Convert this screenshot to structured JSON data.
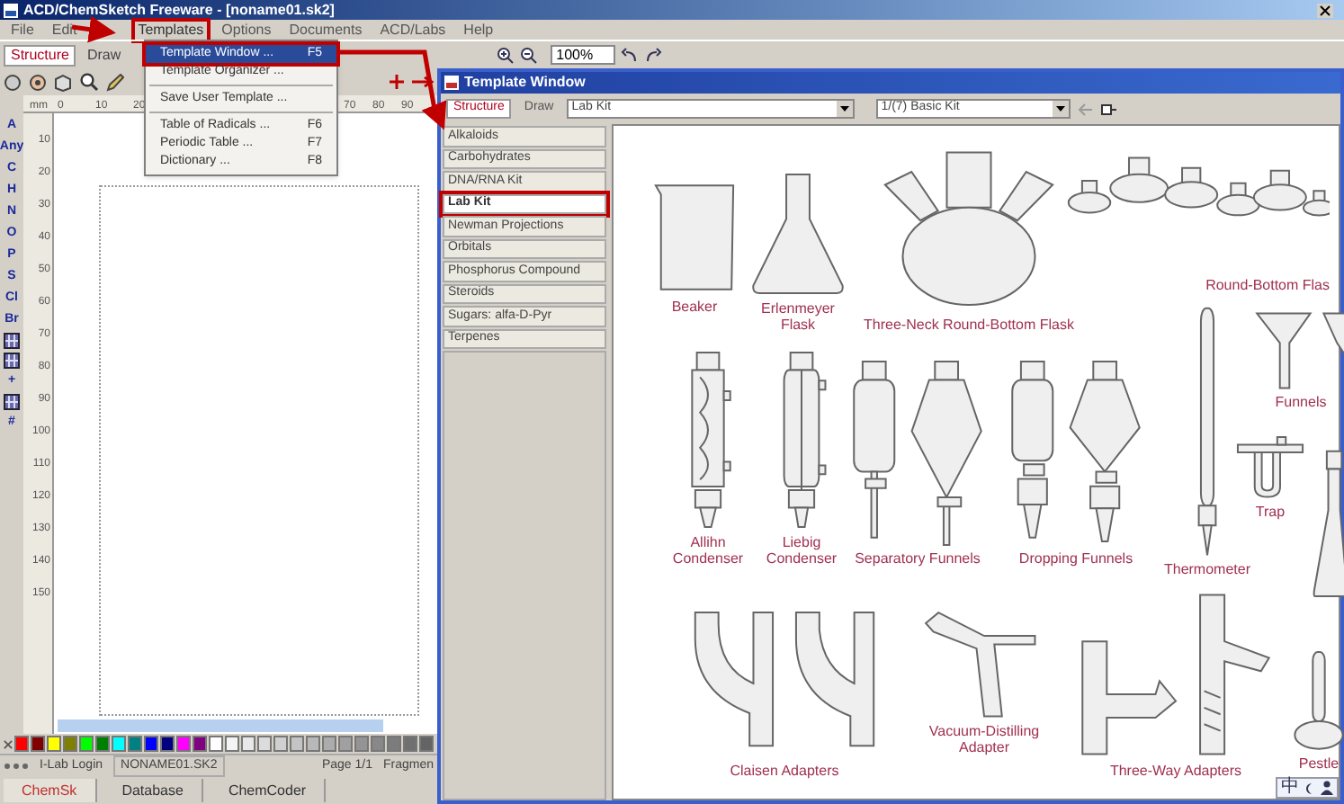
{
  "window": {
    "title": "ACD/ChemSketch Freeware - [noname01.sk2]"
  },
  "menu_bar": [
    {
      "label": "File",
      "highlighted": false
    },
    {
      "label": "Edit",
      "highlighted": false
    },
    {
      "label": "Templates",
      "highlighted": true
    },
    {
      "label": "Options",
      "highlighted": false
    },
    {
      "label": "Documents",
      "highlighted": false
    },
    {
      "label": "ACD/Labs",
      "highlighted": false
    },
    {
      "label": "Help",
      "highlighted": false
    }
  ],
  "templates_menu": [
    {
      "kind": "item",
      "label": "Template Window ...",
      "shortcut": "F5",
      "selected": true,
      "highlighted": true
    },
    {
      "kind": "item",
      "label": "Template Organizer ...",
      "selected": false,
      "highlighted": false
    },
    {
      "kind": "separator"
    },
    {
      "kind": "item",
      "label": "Save User Template ...",
      "selected": false,
      "highlighted": false
    },
    {
      "kind": "separator"
    },
    {
      "kind": "item",
      "label": "Table of Radicals ...",
      "shortcut": "F6",
      "selected": false,
      "highlighted": false
    },
    {
      "kind": "item",
      "label": "Periodic Table ...",
      "shortcut": "F7",
      "selected": false,
      "highlighted": false
    },
    {
      "kind": "item",
      "label": "Dictionary ...",
      "shortcut": "F8",
      "selected": false,
      "highlighted": false
    }
  ],
  "mode_tabs": [
    {
      "label": "Structure",
      "selected": true
    },
    {
      "label": "Draw",
      "selected": false
    }
  ],
  "zoom_field": {
    "value": "100%"
  },
  "ruler": {
    "unit": "mm",
    "left_ticks": [
      "0",
      "10",
      "20"
    ],
    "right_ticks": [
      "70",
      "80",
      "90"
    ],
    "vertical_ticks": [
      "10",
      "20",
      "30",
      "40",
      "50",
      "60",
      "70",
      "80",
      "90",
      "100",
      "110",
      "120",
      "130",
      "140",
      "150"
    ]
  },
  "atom_toolbar": [
    {
      "kind": "label",
      "label": "A"
    },
    {
      "kind": "label",
      "label": "Any"
    },
    {
      "kind": "label",
      "label": "C"
    },
    {
      "kind": "label",
      "label": "H"
    },
    {
      "kind": "label",
      "label": "N"
    },
    {
      "kind": "label",
      "label": "O"
    },
    {
      "kind": "label",
      "label": "P"
    },
    {
      "kind": "label",
      "label": "S"
    },
    {
      "kind": "label",
      "label": "Cl"
    },
    {
      "kind": "label",
      "label": "Br"
    },
    {
      "kind": "icon"
    },
    {
      "kind": "icon"
    },
    {
      "kind": "label",
      "label": "+"
    },
    {
      "kind": "icon"
    },
    {
      "kind": "label",
      "label": "#"
    }
  ],
  "palette": [
    {
      "color": "#ff0000"
    },
    {
      "color": "#800000"
    },
    {
      "color": "#ffff00"
    },
    {
      "color": "#808000"
    },
    {
      "color": "#00ff00"
    },
    {
      "color": "#008000"
    },
    {
      "color": "#00ffff"
    },
    {
      "color": "#008080"
    },
    {
      "color": "#0000ff"
    },
    {
      "color": "#000080"
    },
    {
      "color": "#ff00ff"
    },
    {
      "color": "#800080"
    },
    {
      "color": "#ffffff"
    },
    {
      "color": "#f4f4f4"
    },
    {
      "color": "#e8e8e8"
    },
    {
      "color": "#dcdcdc"
    },
    {
      "color": "#d0d0d0"
    },
    {
      "color": "#c4c4c4"
    },
    {
      "color": "#b8b8b8"
    },
    {
      "color": "#acacac"
    },
    {
      "color": "#a0a0a0"
    },
    {
      "color": "#949494"
    },
    {
      "color": "#888888"
    },
    {
      "color": "#7c7c7c"
    },
    {
      "color": "#707070"
    },
    {
      "color": "#646464"
    }
  ],
  "status_bar": {
    "login": "I-Lab Login",
    "file": "NONAME01.SK2",
    "page": "Page 1/1",
    "mode": "Fragmen"
  },
  "bottom_tabs": [
    {
      "label": "ChemSk",
      "selected": true
    },
    {
      "label": "Database",
      "selected": false
    },
    {
      "label": "ChemCoder",
      "selected": false
    }
  ],
  "template_window": {
    "title": "Template Window",
    "tabs": [
      {
        "label": "Structure",
        "selected": true
      },
      {
        "label": "Draw",
        "selected": false
      }
    ],
    "category_select": {
      "value": "Lab Kit"
    },
    "page_select": {
      "value": "1/(7) Basic Kit"
    },
    "categories": [
      {
        "label": "Alkaloids",
        "selected": false,
        "highlighted": false
      },
      {
        "label": "Carbohydrates",
        "selected": false,
        "highlighted": false
      },
      {
        "label": "DNA/RNA Kit",
        "selected": false,
        "highlighted": false
      },
      {
        "label": "Lab Kit",
        "selected": true,
        "highlighted": true
      },
      {
        "label": "Newman Projections",
        "selected": false,
        "highlighted": false
      },
      {
        "label": "Orbitals",
        "selected": false,
        "highlighted": false
      },
      {
        "label": "Phosphorus Compound",
        "selected": false,
        "highlighted": false
      },
      {
        "label": "Steroids",
        "selected": false,
        "highlighted": false
      },
      {
        "label": "Sugars: alfa-D-Pyr",
        "selected": false,
        "highlighted": false
      },
      {
        "label": "Terpenes",
        "selected": false,
        "highlighted": false
      }
    ],
    "items": [
      {
        "kind": "beaker",
        "label": "Beaker"
      },
      {
        "kind": "erlenmeyer",
        "label": "Erlenmeyer Flask"
      },
      {
        "kind": "three-neck",
        "label": "Three-Neck Round-Bottom Flask"
      },
      {
        "kind": "round-bottom",
        "label": "Round-Bottom Flas"
      },
      {
        "kind": "allihn",
        "label": "Allihn Condenser"
      },
      {
        "kind": "liebig",
        "label": "Liebig Condenser"
      },
      {
        "kind": "separatory",
        "label": "Separatory Funnels"
      },
      {
        "kind": "dropping",
        "label": "Dropping Funnels"
      },
      {
        "kind": "thermometer",
        "label": "Thermometer"
      },
      {
        "kind": "funnel",
        "label": "Funnels"
      },
      {
        "kind": "trap",
        "label": "Trap"
      },
      {
        "kind": "large-flask"
      },
      {
        "kind": "claisen",
        "label": "Claisen Adapters"
      },
      {
        "kind": "vacuum",
        "label": "Vacuum-Distilling Adapter"
      },
      {
        "kind": "three-way",
        "label": "Three-Way Adapters"
      },
      {
        "kind": "pestle",
        "label": "Pestle"
      }
    ]
  },
  "ime_bar": {
    "label": "中"
  }
}
